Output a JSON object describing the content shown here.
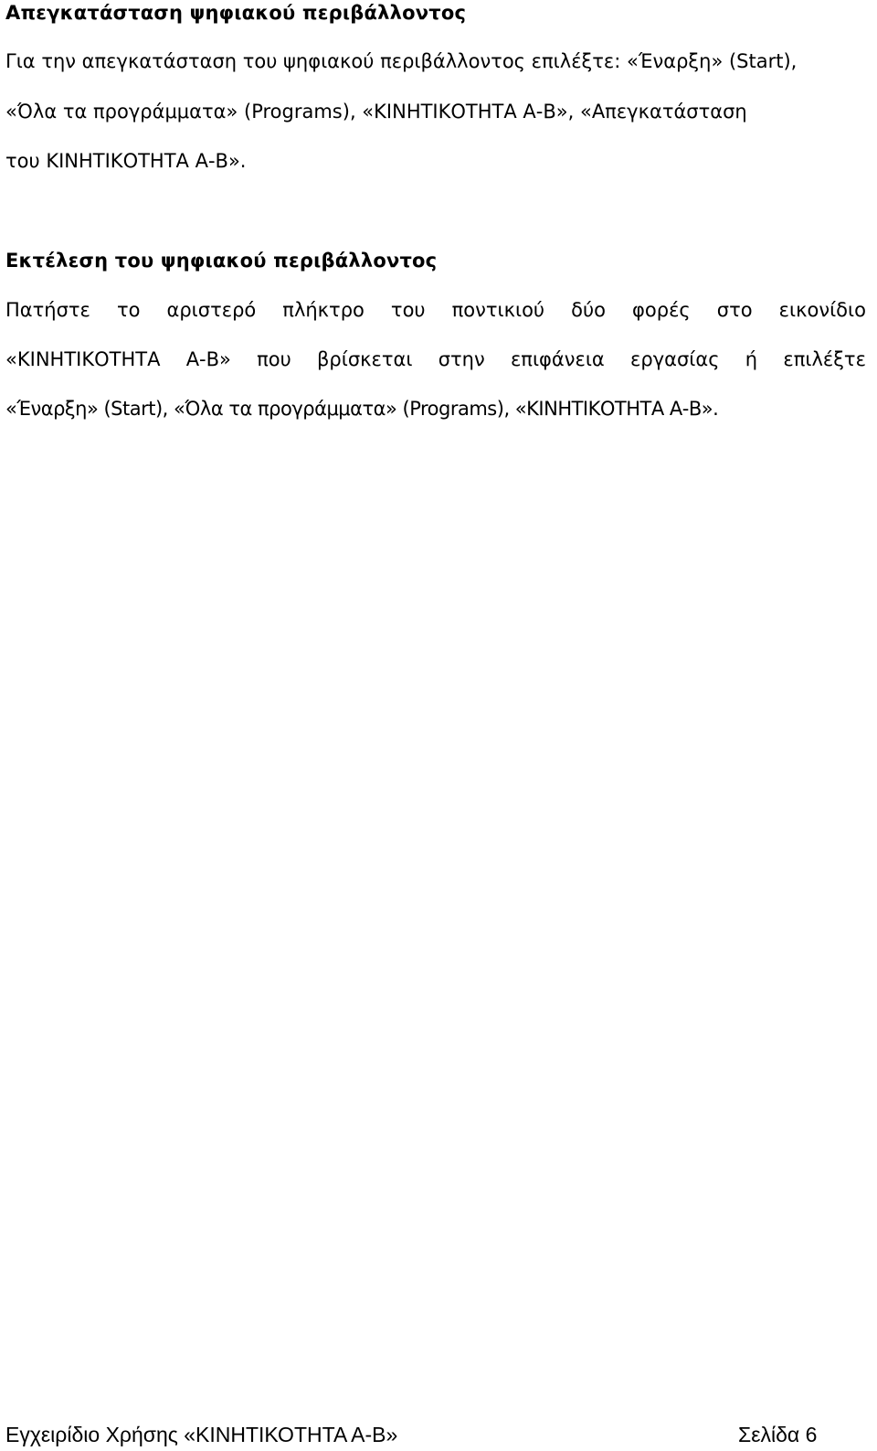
{
  "section1": {
    "heading": "Απεγκατάσταση ψηφιακού περιβάλλοντος",
    "lines": [
      "Για την απεγκατάσταση του ψηφιακού περιβάλλοντος επιλέξτε: «Έναρξη» (Start),",
      "«Όλα τα προγράμματα» (Programs), «ΚΙΝΗΤΙΚΟΤΗΤΑ Α-Β», «Απεγκατάσταση",
      "του ΚΙΝΗΤΙΚΟΤΗΤΑ Α-Β»."
    ]
  },
  "section2": {
    "heading": "Εκτέλεση του ψηφιακού περιβάλλοντος",
    "line1_words": [
      "Πατήστε",
      "το",
      "αριστερό",
      "πλήκτρο",
      "του",
      "ποντικιού",
      "δύο",
      "φορές",
      "στο",
      "εικονίδιο"
    ],
    "line2_words": [
      "«ΚΙΝΗΤΙΚΟΤΗΤΑ",
      "Α-Β»",
      "που",
      "βρίσκεται",
      "στην",
      "επιφάνεια",
      "εργασίας",
      "ή",
      "επιλέξτε"
    ],
    "line3": "«Έναρξη» (Start), «Όλα τα προγράμματα» (Programs), «ΚΙΝΗΤΙΚΟΤΗΤΑ Α-Β»."
  },
  "footer": {
    "title": "Εγχειρίδιο Χρήσης «ΚΙΝΗΤΙΚΟΤΗΤΑ Α-Β»",
    "page": "Σελίδα 6"
  }
}
